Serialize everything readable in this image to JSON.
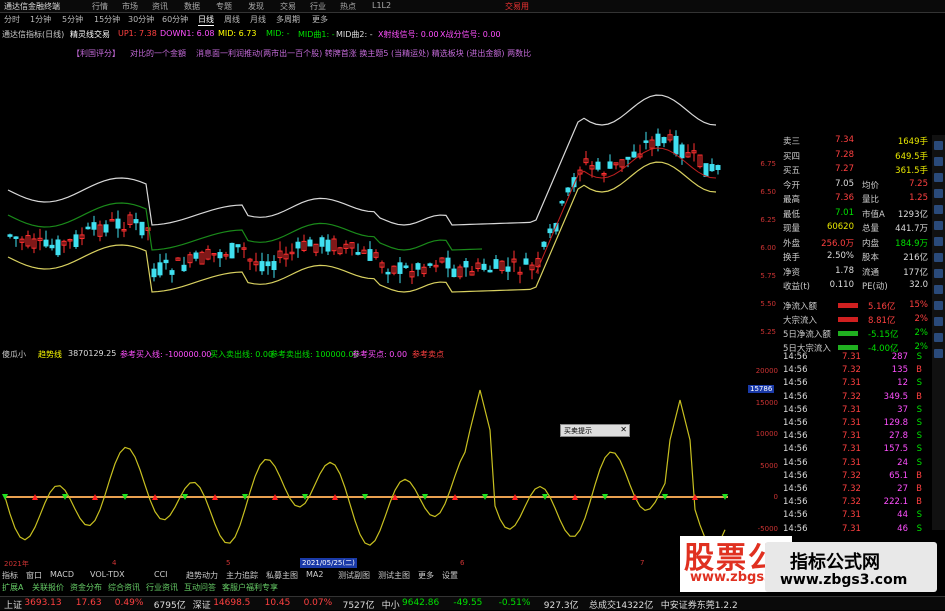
{
  "titlebar": {
    "app": "通达信金融终端",
    "menu": [
      "行情",
      "市场",
      "资讯",
      "数据",
      "专题",
      "发现",
      "交易",
      "行业",
      "热点",
      "L1L2"
    ],
    "right": "交易用"
  },
  "toolbar": {
    "items": [
      "分时",
      "1分钟",
      "5分钟",
      "15分钟",
      "30分钟",
      "60分钟",
      "日线",
      "周线",
      "月线",
      "多周期",
      "更多"
    ],
    "selected": "日线"
  },
  "indline": {
    "name": "通达信指标(日线)",
    "title": "精灵线交易",
    "parts": [
      {
        "t": "UP1: 7.38",
        "c": "#ff4040"
      },
      {
        "t": "DOWN1: 6.08",
        "c": "#ff50ff"
      },
      {
        "t": "MID: 6.73",
        "c": "#ffff00"
      },
      {
        "t": "MID: -",
        "c": "#00e000"
      },
      {
        "t": "MID曲1: -",
        "c": "#00e000"
      },
      {
        "t": "MID曲2: -",
        "c": "#ddd"
      },
      {
        "t": "X射线信号: 0.00",
        "c": "#ff50ff"
      },
      {
        "t": "X战分信号: 0.00",
        "c": "#ff50ff"
      }
    ]
  },
  "magline": [
    "【利国评分】",
    "对比的一个金額",
    "消息面一利润推动",
    "(两市出一百个股) 转牌首涨 换主题5 (当精运处) 精选板块 (进出金额) 两数比"
  ],
  "main_yaxis": [
    "6.75",
    "6.50",
    "6.25",
    "6.00",
    "5.75",
    "5.50",
    "5.25"
  ],
  "info": {
    "rows": [
      {
        "k": "卖三",
        "v1": "7.34",
        "c1": "red",
        "k2": "",
        "v2": "1649手",
        "c2": "yel"
      },
      {
        "k": "买四",
        "v1": "7.28",
        "c1": "red",
        "k2": "",
        "v2": "649.5手",
        "c2": "yel"
      },
      {
        "k": "买五",
        "v1": "7.27",
        "c1": "red",
        "k2": "",
        "v2": "361.5手",
        "c2": "yel"
      },
      {
        "k": "今开",
        "v1": "7.05",
        "c1": "wht",
        "k2": "均价",
        "v2": "7.25",
        "c2": "red"
      },
      {
        "k": "最高",
        "v1": "7.36",
        "c1": "red",
        "k2": "量比",
        "v2": "1.25",
        "c2": "red"
      },
      {
        "k": "最低",
        "v1": "7.01",
        "c1": "green",
        "k2": "市值A",
        "v2": "1293亿",
        "c2": "wht"
      },
      {
        "k": "现量",
        "v1": "60620",
        "c1": "yel",
        "k2": "总量",
        "v2": "441.7万",
        "c2": "wht"
      },
      {
        "k": "外盘",
        "v1": "256.0万",
        "c1": "red",
        "k2": "内盘",
        "v2": "184.9万",
        "c2": "green"
      },
      {
        "k": "换手",
        "v1": "2.50%",
        "c1": "wht",
        "k2": "股本",
        "v2": "216亿",
        "c2": "wht"
      },
      {
        "k": "净资",
        "v1": "1.78",
        "c1": "wht",
        "k2": "流通",
        "v2": "177亿",
        "c2": "wht"
      },
      {
        "k": "收益(t)",
        "v1": "0.110",
        "c1": "wht",
        "k2": "PE(动)",
        "v2": "32.0",
        "c2": "wht"
      }
    ],
    "flows": [
      {
        "k": "净流入额",
        "v": "5.16亿",
        "pct": "15%",
        "c": "red"
      },
      {
        "k": "大宗流入",
        "v": "8.81亿",
        "pct": "2%",
        "c": "red"
      },
      {
        "k": "5日净流入额",
        "v": "-5.15亿",
        "pct": "2%",
        "c": "green"
      },
      {
        "k": "5日大宗流入",
        "v": "-4.00亿",
        "pct": "2%",
        "c": "green"
      }
    ]
  },
  "trades": [
    {
      "t": "14:56",
      "p": "7.31",
      "v": "287",
      "d": "S"
    },
    {
      "t": "14:56",
      "p": "7.32",
      "v": "135",
      "d": "B"
    },
    {
      "t": "14:56",
      "p": "7.31",
      "v": "12",
      "d": "S"
    },
    {
      "t": "14:56",
      "p": "7.32",
      "v": "349.5",
      "d": "B"
    },
    {
      "t": "14:56",
      "p": "7.31",
      "v": "37",
      "d": "S"
    },
    {
      "t": "14:56",
      "p": "7.31",
      "v": "129.8",
      "d": "S"
    },
    {
      "t": "14:56",
      "p": "7.31",
      "v": "27.8",
      "d": "S"
    },
    {
      "t": "14:56",
      "p": "7.31",
      "v": "157.5",
      "d": "S"
    },
    {
      "t": "14:56",
      "p": "7.31",
      "v": "24",
      "d": "S"
    },
    {
      "t": "14:56",
      "p": "7.32",
      "v": "65.1",
      "d": "B"
    },
    {
      "t": "14:56",
      "p": "7.32",
      "v": "27",
      "d": "B"
    },
    {
      "t": "14:56",
      "p": "7.32",
      "v": "222.1",
      "d": "B"
    },
    {
      "t": "14:56",
      "p": "7.31",
      "v": "44",
      "d": "S"
    },
    {
      "t": "14:56",
      "p": "7.31",
      "v": "46",
      "d": "S"
    }
  ],
  "sub": {
    "name": "傻瓜小",
    "title": "趋势线",
    "parts": [
      {
        "t": "3870129.25",
        "c": "#ddd"
      },
      {
        "t": "参考买入线: -100000.00",
        "c": "#ff50ff"
      },
      {
        "t": "买入卖出线: 0.00",
        "c": "#00e000"
      },
      {
        "t": "参考卖出线: 100000.00",
        "c": "#00e000"
      },
      {
        "t": "参考买点: 0.00",
        "c": "#ff50ff"
      },
      {
        "t": "参考卖点",
        "c": "#ff4040"
      }
    ],
    "yaxis": [
      "20000",
      "15000",
      "10000",
      "5000",
      "0",
      "-5000"
    ],
    "marker": "15786"
  },
  "popup": "买卖提示",
  "datebar": {
    "year": "2021年",
    "months": [
      "4",
      "5",
      "6",
      "7"
    ],
    "sel": "2021/05/25(二)"
  },
  "tabs": [
    "指标",
    "窗口",
    "MACD",
    "VOL-TDX",
    "CCI",
    "趋势动力",
    "主力追踪",
    "私募主图",
    "MA2",
    "测试副图",
    "测试主图",
    "更多",
    "设置"
  ],
  "tabs2": [
    "扩展A",
    "关联报价",
    "资金分布",
    "综合资讯",
    "行业资讯",
    "互动问答",
    "客服户福利专享"
  ],
  "status": [
    {
      "t": "上证",
      "c": "wht"
    },
    {
      "t": "3693.13",
      "c": "red"
    },
    {
      "t": "17.63",
      "c": "red"
    },
    {
      "t": "0.49%",
      "c": "red"
    },
    {
      "t": "6795亿",
      "c": "wht"
    },
    {
      "t": "深证",
      "c": "wht"
    },
    {
      "t": "14698.5",
      "c": "red"
    },
    {
      "t": "10.45",
      "c": "red"
    },
    {
      "t": "0.07%",
      "c": "red"
    },
    {
      "t": "7527亿",
      "c": "wht"
    },
    {
      "t": "中小",
      "c": "wht"
    },
    {
      "t": "9642.86",
      "c": "green"
    },
    {
      "t": "-49.55",
      "c": "green"
    },
    {
      "t": "-0.51%",
      "c": "green"
    },
    {
      "t": "927.3亿",
      "c": "wht"
    },
    {
      "t": "总成交",
      "c": "wht"
    },
    {
      "t": "14322亿",
      "c": "wht"
    },
    {
      "t": "中安证券东莞1.2.2",
      "c": "wht"
    }
  ],
  "watermark": {
    "logo": "股票公式网",
    "sub": "www.zbgs3.com",
    "badge": "指标公式网",
    "badge_url": "www.zbgs3.com"
  }
}
